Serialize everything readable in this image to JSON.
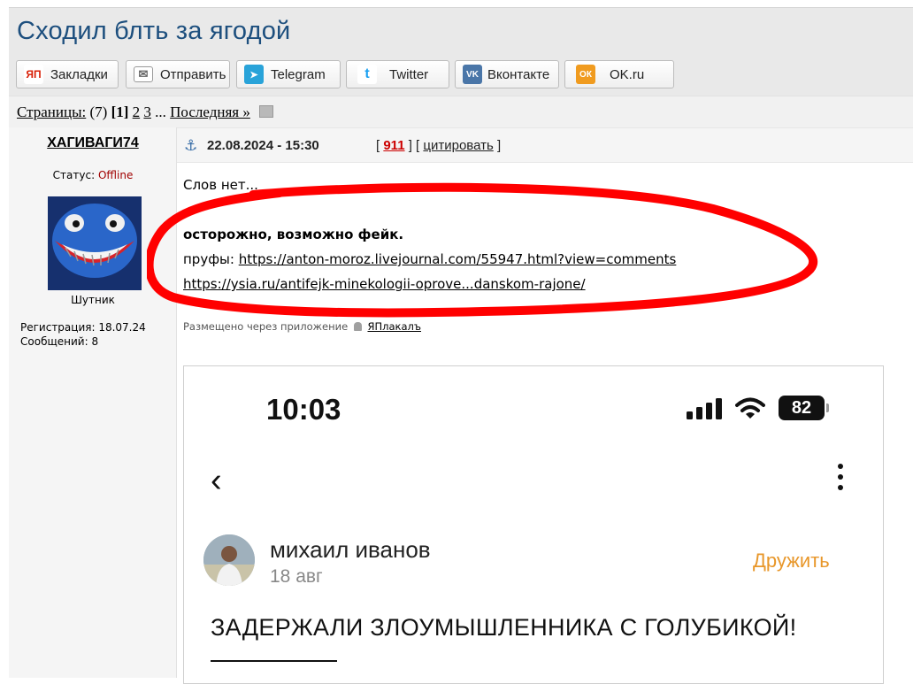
{
  "topic": {
    "title": "Сходил блть за ягодой"
  },
  "share": {
    "buttons": [
      {
        "label": "Закладки",
        "icon": "yandex-bookmarks-icon",
        "glyph": "ЯП",
        "color": "#d81e05"
      },
      {
        "label": "Отправить",
        "icon": "envelope-icon",
        "glyph": "✉",
        "color": "#ffffff"
      },
      {
        "label": "Telegram",
        "icon": "telegram-icon",
        "glyph": "➤",
        "color": "#29a3d9"
      },
      {
        "label": "Twitter",
        "icon": "twitter-icon",
        "glyph": "t",
        "color": "#ffffff"
      },
      {
        "label": "Вконтакте",
        "icon": "vk-icon",
        "glyph": "VK",
        "color": "#4a76a8"
      },
      {
        "label": "OK.ru",
        "icon": "ok-icon",
        "glyph": "ОК",
        "color": "#f09b1f"
      }
    ]
  },
  "pagination": {
    "label": "Страницы:",
    "total": "(7)",
    "current": "[1]",
    "page2": "2",
    "page3": "3",
    "ellipsis": "...",
    "last": "Последняя »"
  },
  "post": {
    "author": {
      "name": "ХАГИВАГИ74",
      "status_label": "Статус:",
      "status_value": "Offline",
      "title": "Шутник",
      "registration": "Регистрация: 18.07.24",
      "messages": "Сообщений: 8"
    },
    "datetime": "22.08.2024 - 15:30",
    "rating": "911",
    "quote_label": "цитировать",
    "text_intro": "Слов нет...",
    "warning": "осторожно, возможно фейк.",
    "proofs_label": "пруфы:",
    "link1": "https://anton-moroz.livejournal.com/55947.html?view=comments",
    "link2": "https://ysia.ru/antifejk-minekologii-oprove...danskom-rajone/",
    "posted_via_label": "Размещено через приложение",
    "app_name": "ЯПлакалъ",
    "screenshot": {
      "time": "10:03",
      "battery": "82",
      "profile_name": "михаил иванов",
      "profile_date": "18 авг",
      "friend_label": "Дружить",
      "headline": "ЗАДЕРЖАЛИ ЗЛОУМЫШЛЕННИКА С ГОЛУБИКОЙ!"
    }
  },
  "colors": {
    "title": "#1d4f7e",
    "offline": "#a00000",
    "rating": "#cc0000",
    "annotation": "#ff0000",
    "friend": "#e8972a"
  }
}
